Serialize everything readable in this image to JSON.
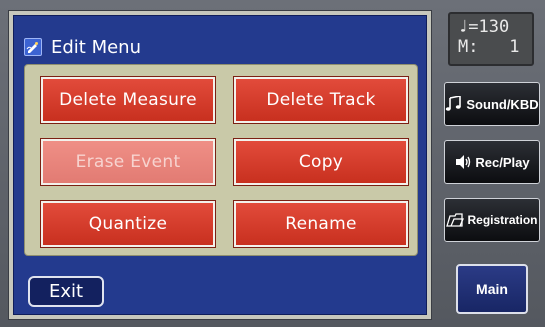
{
  "header": {
    "title": "Edit Menu",
    "icon": "edit-menu-icon"
  },
  "edit_buttons": [
    {
      "label": "Delete Measure",
      "enabled": true
    },
    {
      "label": "Delete Track",
      "enabled": true
    },
    {
      "label": "Erase Event",
      "enabled": false
    },
    {
      "label": "Copy",
      "enabled": true
    },
    {
      "label": "Quantize",
      "enabled": true
    },
    {
      "label": "Rename",
      "enabled": true
    }
  ],
  "footer": {
    "exit_label": "Exit"
  },
  "status": {
    "tempo_symbol": "♩",
    "tempo": "=130",
    "measure_label": "M:",
    "measure": "1"
  },
  "side_buttons": [
    {
      "label": "Sound/KBD",
      "icon": "music-note-icon"
    },
    {
      "label": "Rec/Play",
      "icon": "speaker-icon"
    },
    {
      "label": "Registration",
      "icon": "folder-icon"
    }
  ],
  "main_label": "Main",
  "colors": {
    "panel_blue": "#233a8e",
    "button_red": "#d63a2a",
    "button_disabled": "#ea857c",
    "inner_box": "#c9c9a8"
  }
}
